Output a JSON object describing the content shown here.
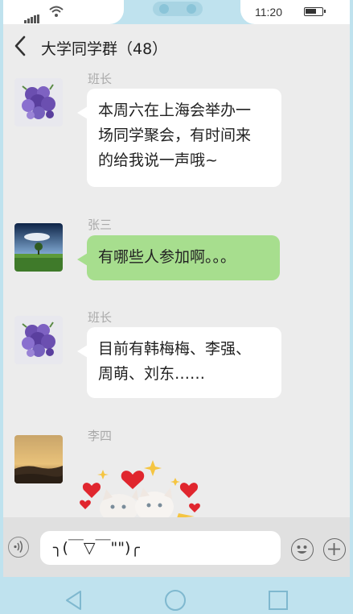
{
  "status_bar": {
    "time": "11:20"
  },
  "header": {
    "title": "大学同学群（48）"
  },
  "messages": [
    {
      "sender": "班长",
      "text_lines": [
        "本周六在上海会举办一",
        "场同学聚会，有时间来",
        "的给我说一声哦~"
      ],
      "avatar": "lavender-bouquet",
      "bubble": "white"
    },
    {
      "sender": "张三",
      "text_lines": [
        "有哪些人参加啊。。。"
      ],
      "avatar": "tree-field-landscape",
      "bubble": "green"
    },
    {
      "sender": "班长",
      "text_lines": [
        "目前有韩梅梅、李强、",
        "周萌、刘东……"
      ],
      "avatar": "lavender-bouquet",
      "bubble": "white"
    },
    {
      "sender": "李四",
      "sticker": "cats-with-hearts",
      "avatar": "sunset-landscape"
    }
  ],
  "input": {
    "value": "╮(￣▽￣\"\")╭"
  },
  "icons": {
    "back": "chevron-left-icon",
    "voice": "voice-icon",
    "emoji": "emoji-icon",
    "add": "plus-icon",
    "nav_back": "triangle-back-icon",
    "nav_home": "circle-home-icon",
    "nav_recent": "square-recent-icon"
  },
  "colors": {
    "bubble_green": "#a7de8e",
    "bubble_white": "#ffffff",
    "frame": "#bfe2ee"
  }
}
